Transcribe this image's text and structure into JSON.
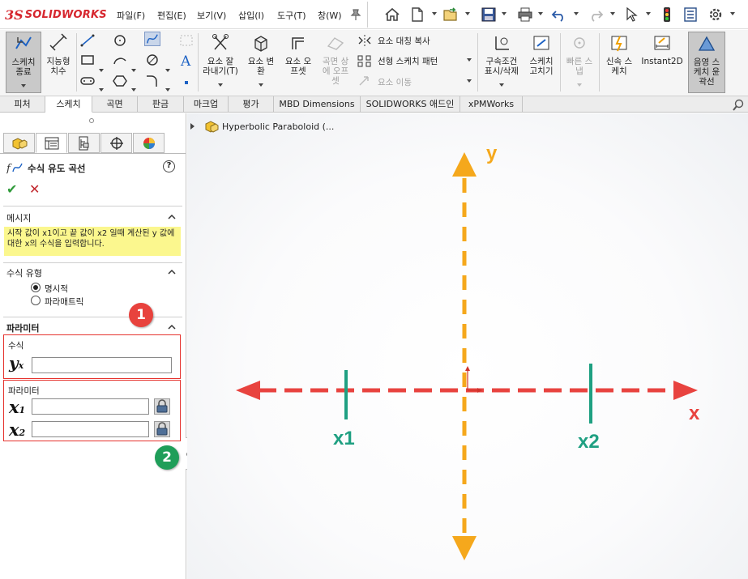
{
  "colors": {
    "brand_red": "#d6262e",
    "axis_red": "#e8433f",
    "axis_orange": "#f5a81c",
    "marker_green": "#1fa082",
    "badge_red": "#e8423d",
    "badge_green": "#1f9e59",
    "message_yellow": "#fbf78e"
  },
  "app": {
    "logo_ds": "3S",
    "logo_text": "SOLIDWORKS"
  },
  "menu": [
    "파일(F)",
    "편집(E)",
    "보기(V)",
    "삽입(I)",
    "도구(T)",
    "창(W)"
  ],
  "toolbar_icons": [
    "home-icon",
    "new-document-icon",
    "open-icon",
    "save-icon",
    "print-icon",
    "undo-icon",
    "redo-icon",
    "select-icon",
    "traffic-light-icon",
    "file-properties-icon",
    "options-gear-icon"
  ],
  "commands": {
    "sketch_exit": "스케치\n종료",
    "smart_dim": "지능형\n치수",
    "trim": "요소 잘\n라내기(T)",
    "convert": "요소 변\n환",
    "offset": "요소 오\n프셋",
    "surface_offset": "곡면 상\n에 오프\n셋",
    "mirror": "요소 대칭 복사",
    "linear_pattern": "선형 스케치 패턴",
    "move": "요소 이동",
    "relations": "구속조건\n표시/삭제",
    "repair": "스케치\n고치기",
    "quick_snap": "빠른 스\n냅",
    "rapid_sketch": "신속 스\n케치",
    "instant2d": "Instant2D",
    "shaded_sketch": "음영 스\n케치 윤\n곽선"
  },
  "tabs": [
    "피처",
    "스케치",
    "곡면",
    "판금",
    "마크업",
    "평가",
    "MBD Dimensions",
    "SOLIDWORKS 애드인",
    "xPMWorks"
  ],
  "active_tab": "스케치",
  "panel": {
    "title": "수식 유도 곡선",
    "help": "?",
    "ok": "✔",
    "cancel": "✕",
    "message_head": "메시지",
    "message": "시작 값이 x1이고 끝 값이 x2 일때 계산된 y 값에 대한 x의 수식을 입력합니다.",
    "type_head": "수식 유형",
    "type_options": [
      "명시적",
      "파라매트릭"
    ],
    "type_selected": "명시적",
    "param_head": "파라미터",
    "equation_label": "수식",
    "equation_symbol": "y",
    "equation_sub": "x",
    "equation_value": "",
    "parameter_label": "파라미터",
    "x1_symbol": "x",
    "x1_sub": "1",
    "x1_value": "",
    "x2_symbol": "x",
    "x2_sub": "2",
    "x2_value": ""
  },
  "badges": {
    "one": "1",
    "two": "2"
  },
  "tree": {
    "root": "Hyperbolic Paraboloid (..."
  },
  "diagram": {
    "y_label": "y",
    "x_label": "x",
    "x1_label": "x1",
    "x2_label": "x2"
  }
}
